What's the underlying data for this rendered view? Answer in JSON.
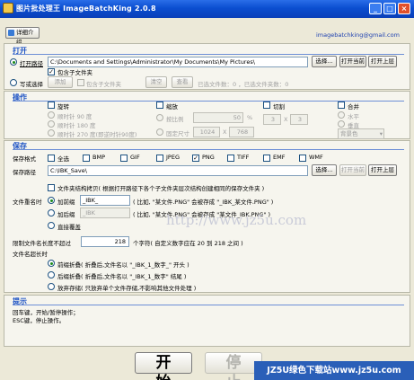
{
  "window": {
    "title": "图片批处理王 ImageBatchKing 2.0.8"
  },
  "header": {
    "intro_button": "详细介绍",
    "email": "imagebatchking@gmail.com"
  },
  "open": {
    "title": "打开",
    "path_label": "打开路径",
    "path_value": "C:\\Documents and Settings\\Administrator\\My Documents\\My Pictures\\",
    "browse": "选择...",
    "open_current": "打开当前",
    "open_parent": "打开上层",
    "include_sub": "包含子文件夹",
    "manual_select": "写或选择",
    "add": "添加",
    "include_sub2": "包含子文件夹",
    "clear": "清空",
    "view": "查看",
    "stats": "已选文件数：0 ，已选文件夹数：0"
  },
  "ops": {
    "title": "操作",
    "rotate": "旋转",
    "rot_cw": "顺时针 90 度",
    "rot_180": "顺时针 180 度",
    "rot_ccw": "顺时针 270 度(即逆时针90度)",
    "scale": "缩放",
    "by_ratio": "按比例",
    "ratio_value": "50",
    "pct": "%",
    "fixed_size": "固定尺寸",
    "fixed_w": "1024",
    "fixed_x": "X",
    "fixed_h": "768",
    "cut": "切割",
    "cut_a": "3",
    "cut_x": "X",
    "cut_b": "3",
    "merge": "合并",
    "horizontal": "水平",
    "vertical": "垂直",
    "bg_select": "背景色"
  },
  "save": {
    "title": "保存",
    "format_label": "保存格式",
    "formats": [
      "全选",
      "BMP",
      "GIF",
      "JPEG",
      "PNG",
      "TIFF",
      "EMF",
      "WMF"
    ],
    "path_label": "保存路径",
    "path_value": "C:\\IBK_Save\\",
    "browse": "选择...",
    "open_current": "打开当前",
    "open_parent": "打开上层",
    "keep_structure": "文件夹结构拷贝( 根据打开路径下各个子文件夹层次结构创建相同的保存文件夹 )",
    "rename_label": "文件重名时",
    "prefix": "加前缀",
    "prefix_value": "_IBK_",
    "prefix_hint": "( 比如, \"某文件.PNG\" 会被存成 \"_IBK_某文件.PNG\" )",
    "suffix": "加后缀",
    "suffix_value": "_IBK",
    "suffix_hint": "( 比如, \"某文件.PNG\" 会被存成 \"某文件_IBK.PNG\" )",
    "overwrite": "直接覆盖",
    "maxlen_label": "限制文件名长度不超过",
    "maxlen_value": "218",
    "maxlen_hint": "个字符( 自定义数字应在 20 到 218 之间 )",
    "toolong_label": "文件名超长时",
    "fold_front": "前缀折叠( 折叠后,文件名以 \"_IBK_1_数字_\" 开头 )",
    "fold_back": "后缀折叠( 折叠后,文件名以 \"_IBK_1_数字\" 结尾 )",
    "skip": "放弃存储( 只放弃单个文件存储,不影响其他文件处理 )"
  },
  "tips": {
    "title": "提示",
    "line1": "回车键，开始/暂停操作；",
    "line2": "ESC键，停止操作。"
  },
  "actions": {
    "start": "开始",
    "stop": "停止"
  },
  "banner": "JZ5U绿色下载站www.jz5u.com",
  "watermark": "http://www.jz5u.com"
}
